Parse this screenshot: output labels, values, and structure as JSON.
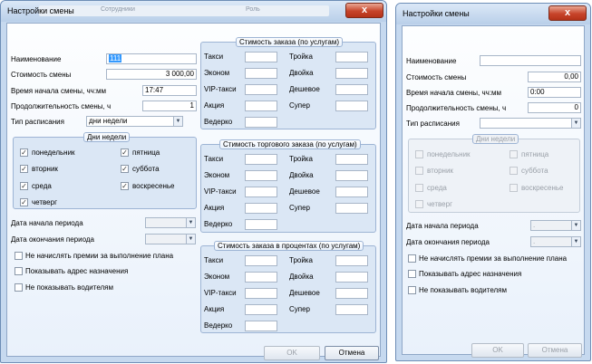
{
  "left_dialog": {
    "title": "Настройки смены",
    "bg_tabs": [
      "Сотрудники",
      "Роль"
    ],
    "close_label": "x",
    "fields": {
      "name_label": "Наименование",
      "name_value": "111",
      "cost_label": "Стоимость смены",
      "cost_value": "3 000,00",
      "start_label": "Время начала смены, чч:мм",
      "start_value": "17:47",
      "duration_label": "Продолжительность смены, ч",
      "duration_value": "1",
      "schedule_label": "Тип расписания",
      "schedule_value": "дни недели"
    },
    "weekdays": {
      "title": "Дни недели",
      "monday": "понедельник",
      "tuesday": "вторник",
      "wednesday": "среда",
      "thursday": "четверг",
      "friday": "пятница",
      "saturday": "суббота",
      "sunday": "воскресенье",
      "checked": [
        true,
        true,
        true,
        true,
        true,
        true,
        true
      ]
    },
    "period": {
      "start_label": "Дата начала периода",
      "end_label": "Дата окончания периода"
    },
    "options": {
      "no_bonus": "Не начислять премии за выполнение плана",
      "show_address": "Показывать адрес назначения",
      "hide_drivers": "Не показывать водителям"
    },
    "price_groups": [
      {
        "title": "Стимость заказа (по услугам)",
        "left": [
          "Такси",
          "Эконом",
          "VIP-такси",
          "Акция",
          "Ведерко"
        ],
        "right": [
          "Тройка",
          "Двойка",
          "Дешевое",
          "Супер"
        ]
      },
      {
        "title": "Стимость торгового заказа (по услугам)",
        "left": [
          "Такси",
          "Эконом",
          "VIP-такси",
          "Акция",
          "Ведерко"
        ],
        "right": [
          "Тройка",
          "Двойка",
          "Дешевое",
          "Супер"
        ]
      },
      {
        "title": "Стимость заказа в процентах (по услугам)",
        "left": [
          "Такси",
          "Эконом",
          "VIP-такси",
          "Акция",
          "Ведерко"
        ],
        "right": [
          "Тройка",
          "Двойка",
          "Дешевое",
          "Супер"
        ]
      }
    ],
    "ok_label": "OK",
    "cancel_label": "Отмена"
  },
  "right_dialog": {
    "title": "Настройки смены",
    "close_label": "x",
    "fields": {
      "name_label": "Наименование",
      "name_value": "",
      "cost_label": "Стоимость смены",
      "cost_value": "0,00",
      "start_label": "Время начала смены, чч:мм",
      "start_value": "0:00",
      "duration_label": "Продолжительность смены, ч",
      "duration_value": "0",
      "schedule_label": "Тип расписания",
      "schedule_value": ""
    },
    "weekdays": {
      "title": "Дни недели",
      "monday": "понедельник",
      "tuesday": "вторник",
      "wednesday": "среда",
      "thursday": "четверг",
      "friday": "пятница",
      "saturday": "суббота",
      "sunday": "воскресенье"
    },
    "period": {
      "start_label": "Дата начала периода",
      "start_value": ".",
      "end_label": "Дата окончания периода",
      "end_value": "."
    },
    "options": {
      "no_bonus": "Не начислять премии за выполнение плана",
      "show_address": "Показывать адрес назначения",
      "hide_drivers": "Не показывать водителям"
    },
    "ok_label": "OK",
    "cancel_label": "Отмена"
  }
}
